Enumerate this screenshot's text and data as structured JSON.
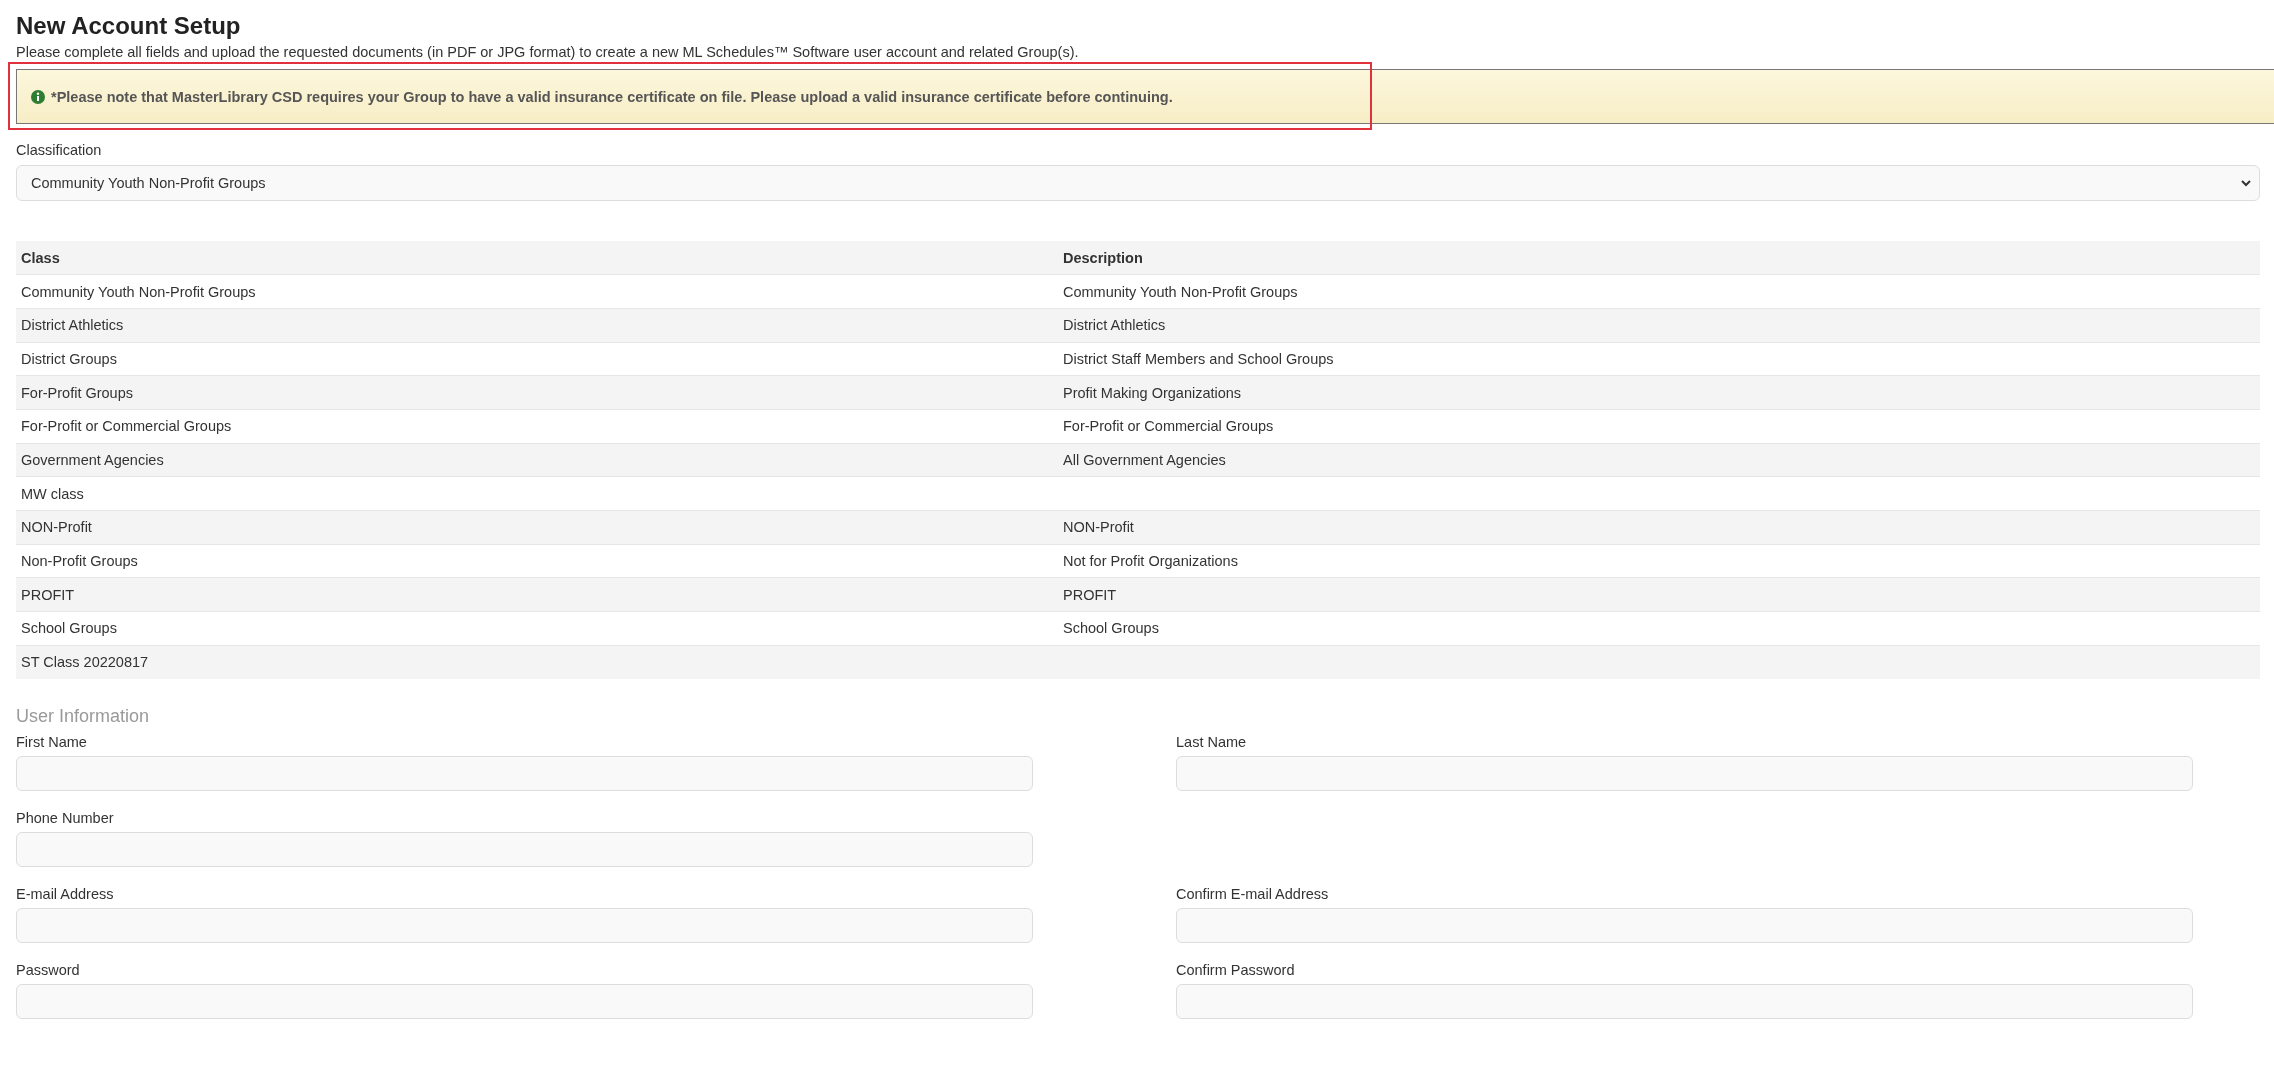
{
  "page": {
    "title": "New Account Setup",
    "subtitle": "Please complete all fields and upload the requested documents (in PDF or JPG format) to create a new ML Schedules™ Software user account and related Group(s)."
  },
  "notice": {
    "text": "*Please note that MasterLibrary CSD requires your Group to have a valid insurance certificate on file. Please upload a valid insurance certificate before continuing.",
    "highlighted": true
  },
  "classification": {
    "label": "Classification",
    "value": "Community Youth Non-Profit Groups"
  },
  "table": {
    "columns": [
      "Class",
      "Description"
    ],
    "rows": [
      {
        "class": "Community Youth Non-Profit Groups",
        "description": "Community Youth Non-Profit Groups"
      },
      {
        "class": "District Athletics",
        "description": "District Athletics"
      },
      {
        "class": "District Groups",
        "description": "District Staff Members and School Groups"
      },
      {
        "class": "For-Profit Groups",
        "description": "Profit Making Organizations"
      },
      {
        "class": "For-Profit or Commercial Groups",
        "description": "For-Profit or Commercial Groups"
      },
      {
        "class": "Government Agencies",
        "description": "All Government Agencies"
      },
      {
        "class": "MW class"
      },
      {
        "class": "NON-Profit",
        "description": "NON-Profit"
      },
      {
        "class": "Non-Profit Groups",
        "description": "Not for Profit Organizations"
      },
      {
        "class": "PROFIT",
        "description": "PROFIT"
      },
      {
        "class": "School Groups",
        "description": "School Groups"
      },
      {
        "class": "ST Class 20220817"
      }
    ]
  },
  "user_information": {
    "heading": "User Information",
    "rows": [
      [
        {
          "label": "First Name"
        },
        {
          "label": "Last Name"
        }
      ],
      [
        {
          "label": "Phone Number"
        }
      ],
      [
        {
          "label": "E-mail Address"
        },
        {
          "label": "Confirm E-mail Address"
        }
      ],
      [
        {
          "label": "Password"
        },
        {
          "label": "Confirm Password"
        }
      ]
    ]
  }
}
